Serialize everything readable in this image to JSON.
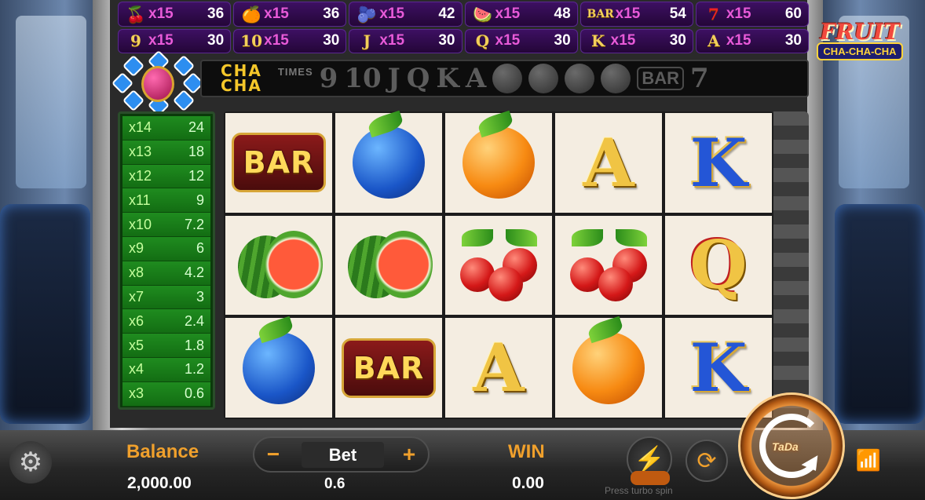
{
  "game": {
    "logo_title": "FRUIT",
    "logo_subtitle": "CHA-CHA-CHA"
  },
  "paytable": [
    {
      "symbol": "cherry",
      "mult": "x15",
      "value": "36"
    },
    {
      "symbol": "orange",
      "mult": "x15",
      "value": "36"
    },
    {
      "symbol": "plum",
      "mult": "x15",
      "value": "42"
    },
    {
      "symbol": "watermelon",
      "mult": "x15",
      "value": "48"
    },
    {
      "symbol": "BAR",
      "mult": "x15",
      "value": "54"
    },
    {
      "symbol": "7",
      "mult": "x15",
      "value": "60"
    },
    {
      "symbol": "9",
      "mult": "x15",
      "value": "30"
    },
    {
      "symbol": "10",
      "mult": "x15",
      "value": "30"
    },
    {
      "symbol": "J",
      "mult": "x15",
      "value": "30"
    },
    {
      "symbol": "Q",
      "mult": "x15",
      "value": "30"
    },
    {
      "symbol": "K",
      "mult": "x15",
      "value": "30"
    },
    {
      "symbol": "A",
      "mult": "x15",
      "value": "30"
    }
  ],
  "chacha": {
    "line1": "CHA",
    "line2": "CHA",
    "times_label": "TIMES",
    "symbols": [
      "9",
      "10",
      "J",
      "Q",
      "K",
      "A"
    ],
    "bar_label": "BAR",
    "seven": "7"
  },
  "ladder": [
    {
      "mult": "x14",
      "value": "24"
    },
    {
      "mult": "x13",
      "value": "18"
    },
    {
      "mult": "x12",
      "value": "12"
    },
    {
      "mult": "x11",
      "value": "9"
    },
    {
      "mult": "x10",
      "value": "7.2"
    },
    {
      "mult": "x9",
      "value": "6"
    },
    {
      "mult": "x8",
      "value": "4.2"
    },
    {
      "mult": "x7",
      "value": "3"
    },
    {
      "mult": "x6",
      "value": "2.4"
    },
    {
      "mult": "x5",
      "value": "1.8"
    },
    {
      "mult": "x4",
      "value": "1.2"
    },
    {
      "mult": "x3",
      "value": "0.6"
    }
  ],
  "reels": {
    "row1": [
      "BAR",
      "plum",
      "orange",
      "A",
      "K"
    ],
    "row2": [
      "watermelon",
      "watermelon",
      "cherries",
      "cherries",
      "Q"
    ],
    "row3": [
      "plum",
      "BAR",
      "A",
      "orange",
      "K"
    ]
  },
  "bottom": {
    "balance_label": "Balance",
    "balance_value": "2,000.00",
    "bet_label": "Bet",
    "bet_value": "0.6",
    "bet_minus": "−",
    "bet_plus": "+",
    "win_label": "WIN",
    "win_value": "0.00",
    "turbo_hint": "Press turbo spin",
    "spin_brand": "TaDa"
  }
}
